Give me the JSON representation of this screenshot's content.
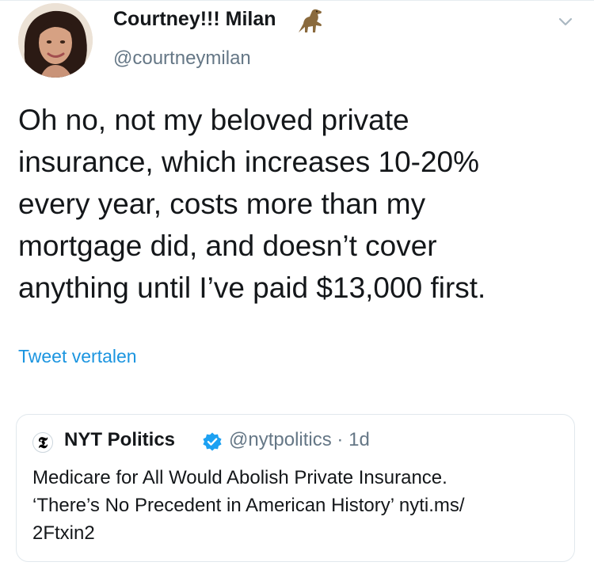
{
  "tweet": {
    "author_name": "Courtney!!! Milan",
    "author_emoji": "dinosaur-icon",
    "author_handle": "@courtneymilan",
    "menu_icon": "chevron-down-icon",
    "text_lines": [
      "Oh no, not my beloved private",
      "insurance, which increases 10-20%",
      "every year, costs more than my",
      "mortgage did, and doesn’t cover",
      "anything until I’ve paid $13,000 first."
    ],
    "translate_label": "Tweet vertalen"
  },
  "quoted_tweet": {
    "logo_glyph": "𝕿",
    "author_name": "NYT Politics",
    "verified_icon": "verified-badge-icon",
    "author_handle": "@nytpolitics",
    "separator": "·",
    "time": "1d",
    "text_lines": [
      "Medicare for All Would Abolish Private Insurance.",
      "‘There’s No Precedent in American History’ nyti.ms/",
      "2Ftxin2"
    ]
  },
  "colors": {
    "text": "#14171a",
    "secondary": "#657786",
    "link": "#1b95e0",
    "verified": "#1da1f2",
    "border": "#e1e8ed"
  }
}
